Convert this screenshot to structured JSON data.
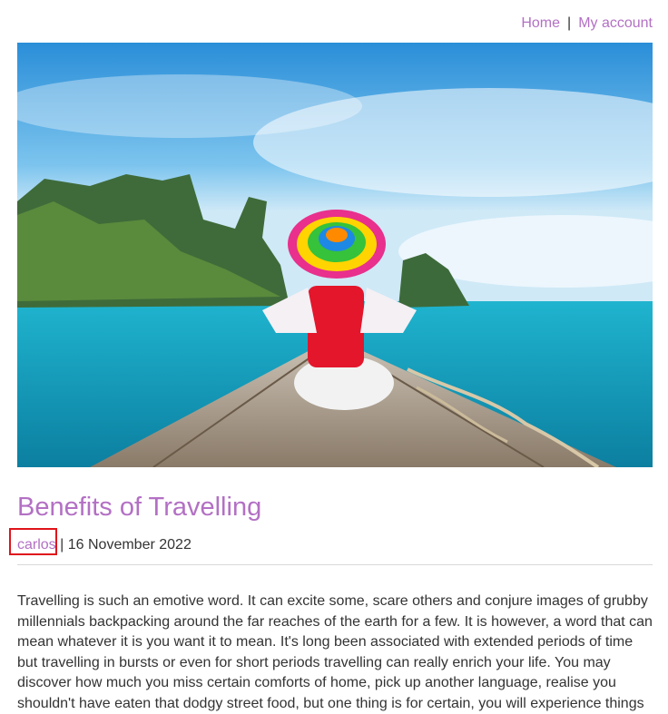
{
  "nav": {
    "home_label": "Home",
    "separator": "|",
    "account_label": "My account",
    "link_color": "#b370c4"
  },
  "hero_image": {
    "alt": "Woman in a rainbow hat sitting on the bow of a long-tail boat, turquoise sea and limestone islands",
    "icon": "photo-icon"
  },
  "post": {
    "title": "Benefits of Travelling",
    "author": "carlos",
    "meta_separator": "|",
    "date": "16 November 2022",
    "body": "Travelling is such an emotive word. It can excite some, scare others and conjure images of grubby millennials backpacking around the far reaches of the earth for a few. It is however, a word that can mean whatever it is you want it to mean. It's long been associated with extended periods of time but travelling in bursts or even for short periods travelling can really enrich your life. You may discover how much you miss certain comforts of home, pick up another language, realise you shouldn't have eaten that dodgy street food, but one thing is for certain, you will experience things"
  },
  "colors": {
    "accent": "#b370c4",
    "highlight": "#e0141b",
    "text": "#333333"
  }
}
